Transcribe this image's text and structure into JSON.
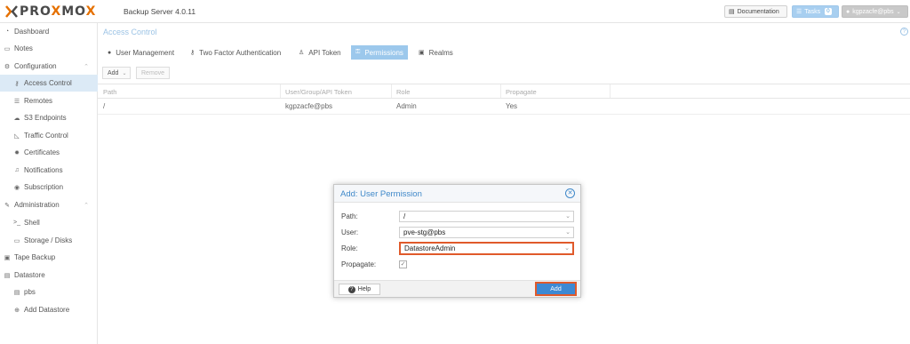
{
  "header": {
    "logo_left": "PRO",
    "logo_x": "X",
    "logo_mid": "MO",
    "logo_x2": "X",
    "product": "Backup Server 4.0.11",
    "documentation": "Documentation",
    "tasks": "Tasks",
    "tasks_count": "0",
    "user": "kgpzacfe@pbs"
  },
  "sidebar": {
    "items": [
      {
        "label": "Dashboard",
        "icon": "dashboard-icon"
      },
      {
        "label": "Notes",
        "icon": "notes-icon"
      },
      {
        "label": "Configuration",
        "icon": "gears-icon"
      },
      {
        "label": "Access Control",
        "icon": "key-icon"
      },
      {
        "label": "Remotes",
        "icon": "server-icon"
      },
      {
        "label": "S3 Endpoints",
        "icon": "cloud-icon"
      },
      {
        "label": "Traffic Control",
        "icon": "chart-icon"
      },
      {
        "label": "Certificates",
        "icon": "certificate-icon"
      },
      {
        "label": "Notifications",
        "icon": "bell-icon"
      },
      {
        "label": "Subscription",
        "icon": "support-icon"
      },
      {
        "label": "Administration",
        "icon": "wrench-icon"
      },
      {
        "label": "Shell",
        "icon": "terminal-icon"
      },
      {
        "label": "Storage / Disks",
        "icon": "hdd-icon"
      },
      {
        "label": "Tape Backup",
        "icon": "tape-icon"
      },
      {
        "label": "Datastore",
        "icon": "database-icon"
      },
      {
        "label": "pbs",
        "icon": "database-icon"
      },
      {
        "label": "Add Datastore",
        "icon": "plus-circle-icon"
      }
    ]
  },
  "main": {
    "title": "Access Control",
    "tabs": [
      {
        "label": "User Management",
        "icon": "user-icon"
      },
      {
        "label": "Two Factor Authentication",
        "icon": "key-icon"
      },
      {
        "label": "API Token",
        "icon": "user-o-icon"
      },
      {
        "label": "Permissions",
        "icon": "unlock-icon"
      },
      {
        "label": "Realms",
        "icon": "address-book-icon"
      }
    ],
    "toolbar": {
      "add": "Add",
      "remove": "Remove"
    },
    "columns": [
      "Path",
      "User/Group/API Token",
      "Role",
      "Propagate"
    ],
    "rows": [
      {
        "path": "/",
        "user": "kgpzacfe@pbs",
        "role": "Admin",
        "propagate": "Yes"
      }
    ]
  },
  "dialog": {
    "title": "Add: User Permission",
    "path_label": "Path:",
    "path_value": "/",
    "user_label": "User:",
    "user_value": "pve-stg@pbs",
    "role_label": "Role:",
    "role_value": "DatastoreAdmin",
    "propagate_label": "Propagate:",
    "propagate_checked": true,
    "help": "Help",
    "add": "Add"
  },
  "colors": {
    "accent": "#3d89d3",
    "highlight": "#e05a2b",
    "logo_x": "#e57000"
  }
}
